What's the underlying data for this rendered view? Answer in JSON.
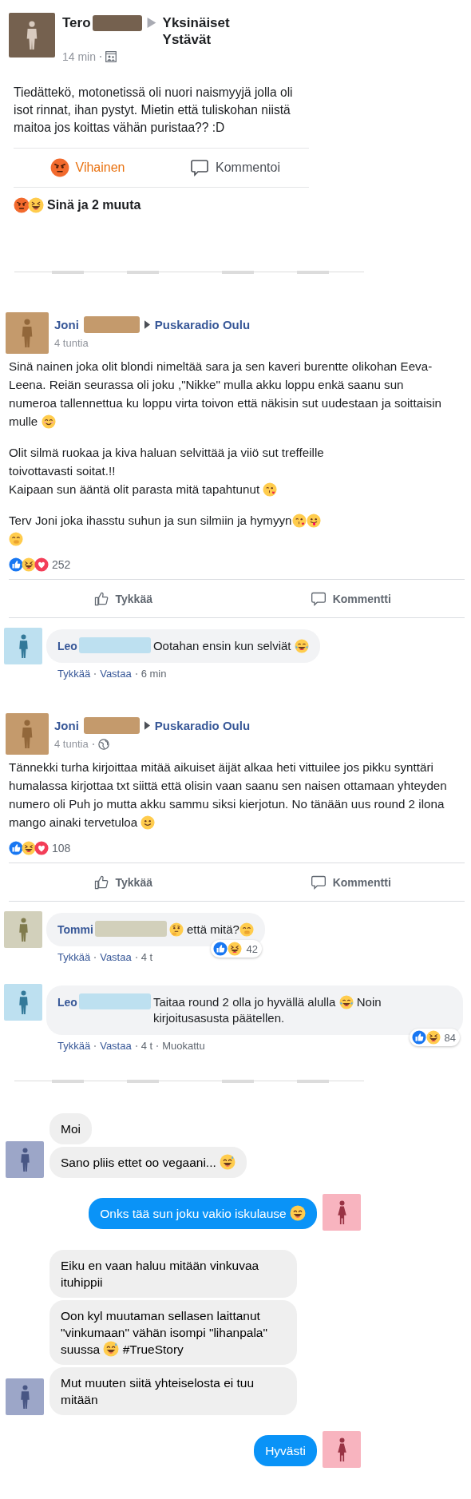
{
  "shared_post": {
    "author": {
      "name": "Tero",
      "color": "#75614f"
    },
    "group": "Yksinäiset Ystävät",
    "time": "14 min",
    "text": "Tiedättekö, motonetissä oli nuori naismyyjä jolla oli isot rinnat, ihan pystyt. Mietin että tuliskohan niistä maitoa jos koittas vähän puristaa?? :D",
    "react_button": {
      "label": "Vihainen",
      "selected": true
    },
    "comment_button": {
      "label": "Kommentoi"
    },
    "summary": {
      "icons": [
        {
          "kind": "angry"
        },
        {
          "kind": "squint"
        }
      ],
      "text": "Sinä ja 2 muuta"
    }
  },
  "posts": [
    {
      "author": {
        "name": "Joni",
        "color": "#c49a6c"
      },
      "group": "Puskaradio Oulu",
      "time": "4 tuntia",
      "paragraphs": [
        [
          [
            {
              "kind": "text",
              "text": "Sinä nainen joka olit blondi nimeltää sara ja sen kaveri burentte olikohan Eeva-Leena. Reiän seurassa oli joku ,\"Nikke\" mulla akku loppu enkä saanu sun numeroa tallennettua ku loppu virta toivon että näkisin sut uudestaan ja soittaisin mulle "
            },
            {
              "kind": "blush"
            }
          ]
        ],
        [
          [
            {
              "kind": "text",
              "text": "Olit silmä ruokaa ja kiva haluan selvittää ja viiö sut  treffeille"
            }
          ],
          [
            {
              "kind": "text",
              "text": "toivottavasti soitat.!!"
            }
          ],
          [
            {
              "kind": "text",
              "text": "Kaipaan sun ääntä olit parasta mitä tapahtunut "
            },
            {
              "kind": "kiss"
            }
          ]
        ],
        [
          [
            {
              "kind": "text",
              "text": "Terv Joni joka ihasstu suhun ja sun silmiin ja hymyyn"
            },
            {
              "kind": "kiss"
            },
            {
              "kind": "tongue"
            }
          ],
          [
            {
              "kind": "hush"
            }
          ]
        ]
      ],
      "reactions": {
        "icons": [
          {
            "kind": "like"
          },
          {
            "kind": "squint"
          },
          {
            "kind": "love"
          }
        ],
        "count": "252"
      },
      "actions": [
        "Tykkää",
        "Kommentti"
      ],
      "comments": [
        {
          "author": {
            "name": "Leo",
            "color": "#bde0f0"
          },
          "segments": [
            {
              "kind": "text",
              "text": "Ootahan ensin kun selviät "
            },
            {
              "kind": "tears"
            }
          ],
          "meta": [
            {
              "kind": "link",
              "text": "Tykkää"
            },
            {
              "kind": "link",
              "text": "Vastaa"
            },
            {
              "kind": "time",
              "text": "6 min"
            }
          ]
        }
      ]
    },
    {
      "author": {
        "name": "Joni",
        "color": "#c49a6c"
      },
      "group": "Puskaradio Oulu",
      "time": "4 tuntia",
      "public": true,
      "paragraphs": [
        [
          [
            {
              "kind": "text",
              "text": "Tännekki turha kirjoittaa mitää aikuiset äijät alkaa heti vittuilee jos pikku synttäri humalassa kirjottaa txt siittä että olisin vaan saanu sen naisen ottamaan yhteyden numero oli Puh jo mutta akku sammu siksi kierjotun. No tänään uus round 2 ilona mango ainaki tervetuloa "
            },
            {
              "kind": "smile"
            }
          ]
        ]
      ],
      "reactions": {
        "icons": [
          {
            "kind": "like"
          },
          {
            "kind": "squint"
          },
          {
            "kind": "love"
          }
        ],
        "count": "108"
      },
      "actions": [
        "Tykkää",
        "Kommentti"
      ],
      "comments": [
        {
          "author": {
            "name": "Tommi",
            "color": "#d2d0bb"
          },
          "segments": [
            {
              "kind": "think"
            },
            {
              "kind": "text",
              "text": " että mitä?"
            },
            {
              "kind": "hush"
            }
          ],
          "badge": {
            "icons": [
              {
                "kind": "like"
              },
              {
                "kind": "squint"
              }
            ],
            "count": "42"
          },
          "meta": [
            {
              "kind": "link",
              "text": "Tykkää"
            },
            {
              "kind": "link",
              "text": "Vastaa"
            },
            {
              "kind": "time",
              "text": "4 t"
            }
          ]
        },
        {
          "author": {
            "name": "Leo",
            "color": "#bde0f0"
          },
          "segments": [
            {
              "kind": "text",
              "text": "Taitaa round 2 olla jo hyvällä alulla "
            },
            {
              "kind": "tears"
            },
            {
              "kind": "text",
              "text": " Noin kirjoitusasusta päätellen."
            }
          ],
          "badge": {
            "icons": [
              {
                "kind": "like"
              },
              {
                "kind": "squint"
              }
            ],
            "count": "84"
          },
          "meta": [
            {
              "kind": "link",
              "text": "Tykkää"
            },
            {
              "kind": "link",
              "text": "Vastaa"
            },
            {
              "kind": "time",
              "text": "4 t"
            },
            {
              "kind": "time",
              "text": "Muokattu"
            }
          ]
        }
      ]
    }
  ],
  "chat": [
    {
      "kind": "received",
      "color": "#9ca6c8",
      "messages": [
        [
          {
            "kind": "text",
            "text": "Moi"
          }
        ],
        [
          {
            "kind": "text",
            "text": "Sano pliis ettet oo vegaani... "
          },
          {
            "kind": "sweat"
          }
        ]
      ]
    },
    {
      "kind": "sent",
      "color": "#f8b4bf",
      "messages": [
        [
          {
            "kind": "text",
            "text": "Onks tää sun joku vakio iskulause "
          },
          {
            "kind": "grin"
          }
        ]
      ]
    },
    {
      "kind": "received",
      "color": "#9ca6c8",
      "messages": [
        [
          {
            "kind": "text",
            "text": "Eiku en vaan haluu mitään vinkuvaa ituhippii"
          }
        ],
        [
          {
            "kind": "text",
            "text": "Oon kyl muutaman sellasen laittanut \"vinkumaan\" vähän isompi \"lihanpala\" suussa "
          },
          {
            "kind": "sweat"
          },
          {
            "kind": "text",
            "text": " #TrueStory"
          }
        ],
        [
          {
            "kind": "text",
            "text": "Mut muuten siitä yhteiselosta ei tuu mitään"
          }
        ]
      ]
    },
    {
      "kind": "sent",
      "color": "#f8b4bf",
      "messages": [
        [
          {
            "kind": "text",
            "text": "Hyvästi"
          }
        ]
      ]
    }
  ]
}
